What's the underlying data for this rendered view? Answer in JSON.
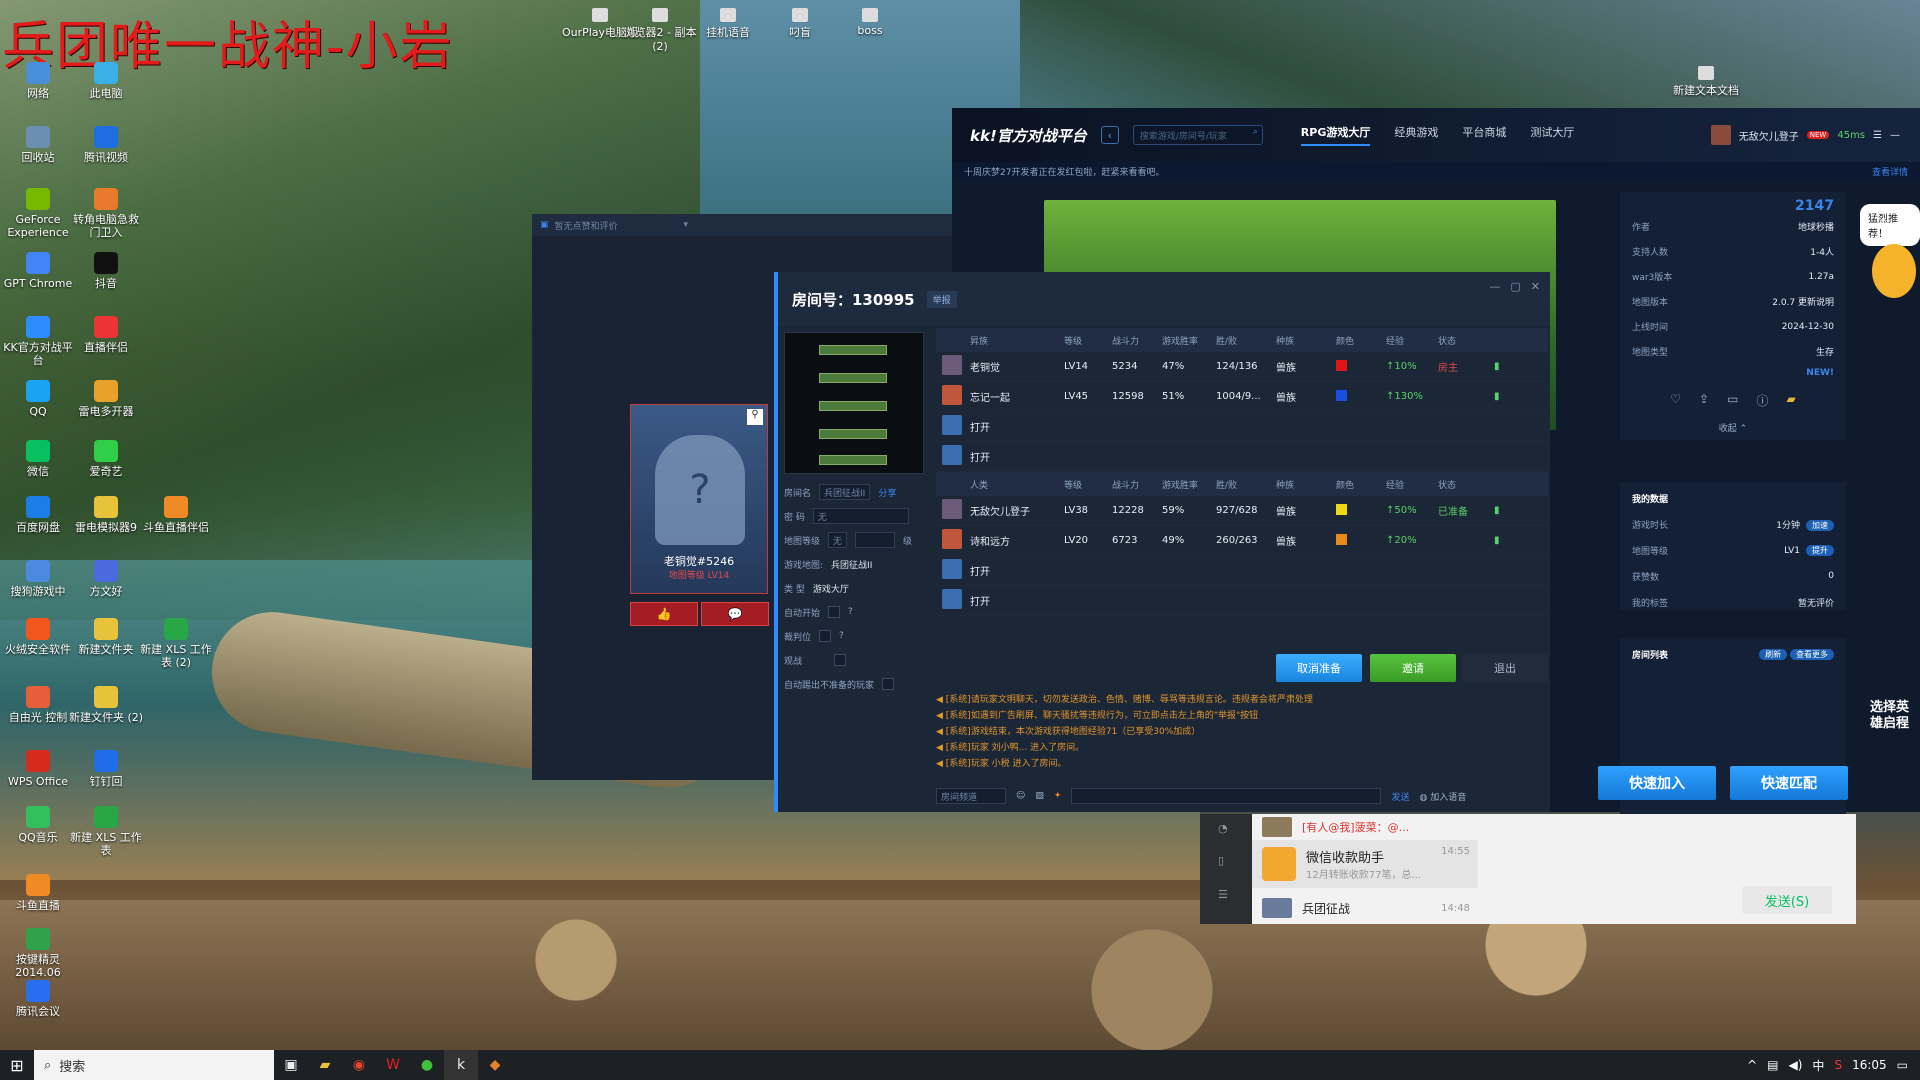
{
  "watermark": "兵团唯一战神-小岩",
  "desktop": {
    "icons": [
      "网络",
      "此电脑",
      "回收站",
      "腾讯视频",
      "GeForce Experience",
      "转角电脑急救门卫入",
      "GPT Chrome",
      "抖音",
      "KK官方对战平台",
      "直播伴侣",
      "QQ",
      "雷电多开器",
      "微信",
      "爱奇艺",
      "百度网盘",
      "雷电模拟器9",
      "斗鱼直播伴侣",
      "搜狗游戏中",
      "方文好",
      "火绒安全软件",
      "新建文件夹",
      "新建 XLS 工作表 (2)",
      "自由光 控制",
      "新建文件夹 (2)",
      "WPS Office",
      "钉钉回",
      "QQ音乐",
      "新建 XLS 工作表",
      "斗鱼直播",
      "按键精灵2014.06",
      "腾讯会议"
    ],
    "top_icons": [
      "OurPlay电脑版",
      "浏览器2 - 副本 (2)",
      "挂机语音",
      "叼盲",
      "boss"
    ],
    "right_icon": "新建文本文档"
  },
  "taskbar": {
    "search": "搜索",
    "time": "16:05",
    "ime": "中"
  },
  "kk": {
    "logo": "kk!官方对战平台",
    "search_placeholder": "搜索游戏/房间号/玩家",
    "nav": [
      "RPG游戏大厅",
      "经典游戏",
      "平台商城",
      "测试大厅"
    ],
    "user": "无敌欠儿登子",
    "new_badge": "NEW",
    "ping": "45ms",
    "ticker": "十周庆梦27开发者正在发红包啦，赶紧来看看吧。",
    "ticker_right": "查看详情",
    "score": "2147",
    "info": [
      {
        "k": "作者",
        "v": "地球秒播"
      },
      {
        "k": "支持人数",
        "v": "1-4人"
      },
      {
        "k": "war3版本",
        "v": "1.27a"
      },
      {
        "k": "地图版本",
        "v": "2.0.7 更新说明"
      },
      {
        "k": "上线时间",
        "v": "2024-12-30"
      },
      {
        "k": "地图类型",
        "v": "生存"
      }
    ],
    "new_tag": "NEW!",
    "collapse": "收起",
    "my_data_title": "我的数据",
    "my_data": [
      {
        "k": "游戏时长",
        "v": "1分钟",
        "btn": "加速"
      },
      {
        "k": "地图等级",
        "v": "LV1",
        "btn": "提升"
      },
      {
        "k": "获赞数",
        "v": "0"
      },
      {
        "k": "我的标签",
        "v": "暂无评价"
      }
    ],
    "room_list_title": "房间列表",
    "refresh": "刷新",
    "see_more": "查看更多",
    "quick_join": "快速加入",
    "quick_match": "快速匹配",
    "float_bubble": "猛烈推荐！",
    "float_side": "选择英雄启程"
  },
  "gamewin": {
    "bar_text": "暂无点赞和评价",
    "card_name": "老铜觉#5246",
    "card_level": "地图等级 LV14",
    "like_icon": "👍",
    "msg_icon": "💬"
  },
  "room": {
    "title": "房间号：130995",
    "tag": "举报",
    "left": {
      "name_label": "房间名",
      "name_value": "兵团征战II",
      "share": "分享",
      "pwd_label": "密 码",
      "pwd_value": "无",
      "level_label": "地图等级",
      "level_value": "无",
      "level_unit": "级",
      "map_label": "游戏地图:",
      "map_value": "兵团征战II",
      "type_label": "类 型",
      "type_value": "游戏大厅",
      "auto_start": "自动开始",
      "referee": "裁判位",
      "watch": "观战",
      "auto_kick": "自动踢出不准备的玩家"
    },
    "headers": [
      "",
      "昇族",
      "等级",
      "战斗力",
      "游戏胜率",
      "胜/败",
      "种族",
      "颜色",
      "经验",
      "状态"
    ],
    "headers2": [
      "",
      "人类",
      "等级",
      "战斗力",
      "游戏胜率",
      "胜/败",
      "种族",
      "颜色",
      "经验",
      "状态"
    ],
    "team1": [
      {
        "name": "老铜觉",
        "lv": "LV14",
        "power": "5234",
        "rate": "47%",
        "wl": "124/136",
        "race": "兽族",
        "color": "#e01515",
        "exp": "↑10%",
        "status": "房主"
      },
      {
        "name": "忘记一起",
        "lv": "LV45",
        "power": "12598",
        "rate": "51%",
        "wl": "1004/9...",
        "race": "兽族",
        "color": "#1a4de0",
        "exp": "↑130%",
        "status": ""
      },
      {
        "name": "打开"
      },
      {
        "name": "打开"
      }
    ],
    "team2": [
      {
        "name": "无敌欠儿登子",
        "lv": "LV38",
        "power": "12228",
        "rate": "59%",
        "wl": "927/628",
        "race": "兽族",
        "color": "#f0d714",
        "exp": "↑50%",
        "status": "已准备"
      },
      {
        "name": "诗和远方",
        "lv": "LV20",
        "power": "6723",
        "rate": "49%",
        "wl": "260/263",
        "race": "兽族",
        "color": "#e88a1a",
        "exp": "↑20%",
        "status": ""
      },
      {
        "name": "打开"
      },
      {
        "name": "打开"
      }
    ],
    "btn_cancel_ready": "取消准备",
    "btn_invite": "邀请",
    "btn_exit": "退出",
    "log": [
      "[系统]请玩家文明聊天，切勿发送政治、色情、赌博、辱骂等违规言论。违规者会将严肃处理",
      "[系统]如遇到广告刷屏、聊天骚扰等违规行为，可立即点击左上角的\"举报\"按钮",
      "[系统]游戏结束，本次游戏获得地图经验71（已享受30%加成）",
      "[系统]玩家 刘小鸭... 进入了房间。",
      "[系统]玩家 小税 进入了房间。"
    ],
    "channel": "房间频道",
    "send": "发送",
    "voice": "加入语音"
  },
  "wechat": {
    "items": [
      {
        "title": "[有人@我]菠菜：@...",
        "time": ""
      },
      {
        "title": "微信收款助手",
        "sub": "12月转账收款77笔，总...",
        "time": "14:55"
      },
      {
        "title": "兵团征战",
        "time": "14:48"
      }
    ],
    "send": "发送(S)"
  }
}
